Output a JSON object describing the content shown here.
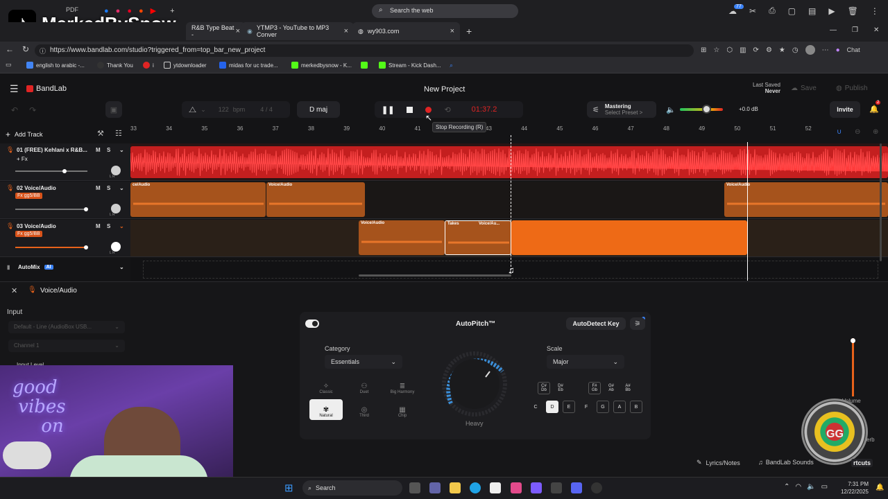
{
  "watermark": {
    "text": "MerkedBySnow"
  },
  "browser": {
    "search_placeholder": "Search the web",
    "notification_count": "77",
    "tabs": [
      {
        "label": "R&B Type Beat -"
      },
      {
        "label": "YTMP3 - YouTube to MP3 Conver"
      },
      {
        "label": "wy903.com"
      }
    ],
    "url": "https://www.bandlab.com/studio?triggered_from=top_bar_new_project",
    "chat_label": "Chat",
    "favorites": [
      "english to arabic -...",
      "Thank You",
      "i",
      "ytdownloader",
      "midas for uc trade...",
      "merkedbysnow - K...",
      "Stream - Kick Dash..."
    ]
  },
  "bandlab": {
    "logo": "BandLab",
    "project_title": "New Project",
    "last_saved_label": "Last Saved",
    "last_saved_value": "Never",
    "save_label": "Save",
    "publish_label": "Publish",
    "bpm_value": "122",
    "bpm_unit": "bpm",
    "time_sig_top": "4",
    "time_sig_sep": "/",
    "time_sig_bottom": "4",
    "key": "D maj",
    "timer": "01:37.2",
    "tooltip": "Stop Recording (R)",
    "mastering_label": "Mastering",
    "mastering_preset": "Select Preset >",
    "volume_db": "+0.0 dB",
    "volume_level": 0.62,
    "invite_label": "Invite",
    "notif_badge": "2",
    "add_track": "Add Track",
    "ruler": [
      "33",
      "34",
      "35",
      "36",
      "37",
      "38",
      "39",
      "40",
      "41",
      "42",
      "43",
      "44",
      "45",
      "46",
      "47",
      "48",
      "49",
      "50",
      "51",
      "52"
    ],
    "tracks": [
      {
        "name": "01  (FREE) Kehlani x R&B...",
        "fx": "+ Fx",
        "m": "M",
        "s": "S",
        "lr": "L  R",
        "volume": 0.68
      },
      {
        "name": "02  Voice/Audio",
        "fx": "Fx gg5/BB",
        "m": "M",
        "s": "S",
        "lr": "L  R",
        "volume": 0.98
      },
      {
        "name": "03  Voice/Audio",
        "fx": "Fx gg5/BB",
        "m": "M",
        "s": "S",
        "lr": "L  R",
        "volume": 0.98
      }
    ],
    "clips": {
      "t2a": "ce/Audio",
      "t2b": "Voice/Audio",
      "t2c": "Voice/Audio",
      "t3a": "Voice/Audio",
      "t3takes": "Takes",
      "t3b": "Voice/Au..."
    },
    "automix": "AutoMix",
    "automix_badge": "AI",
    "panel_title": "Voice/Audio",
    "input_label": "Input",
    "input_device": "Default - Line (AudioBox USB...",
    "input_channel": "Channel 1",
    "input_level": "Input Level",
    "autopitch": {
      "title": "AutoPitch™",
      "detect_key": "AutoDetect Key",
      "category_label": "Category",
      "category_value": "Essentials",
      "styles": [
        "Classic",
        "Duet",
        "Big Harmony",
        "Natural",
        "Third",
        "Chip"
      ],
      "knob_label": "Heavy",
      "scale_label": "Scale",
      "scale_value": "Major",
      "sharps": [
        "C#\nDb",
        "D#\nEb",
        "F#\nGb",
        "G#\nAb",
        "A#\nBb"
      ],
      "naturals": [
        "C",
        "D",
        "E",
        "F",
        "G",
        "A",
        "B"
      ]
    },
    "volume_label": "Volume",
    "reverb_label": "erb",
    "lyrics_label": "Lyrics/Notes",
    "sounds_label": "BandLab Sounds",
    "shortcuts_label": "rtcuts"
  },
  "taskbar": {
    "search": "Search",
    "time": "7:31 PM",
    "date": "12/22/2025"
  },
  "colors": {
    "accent": "#e8621a",
    "red_track": "#d42626",
    "orange_clip": "#b55a1d"
  }
}
